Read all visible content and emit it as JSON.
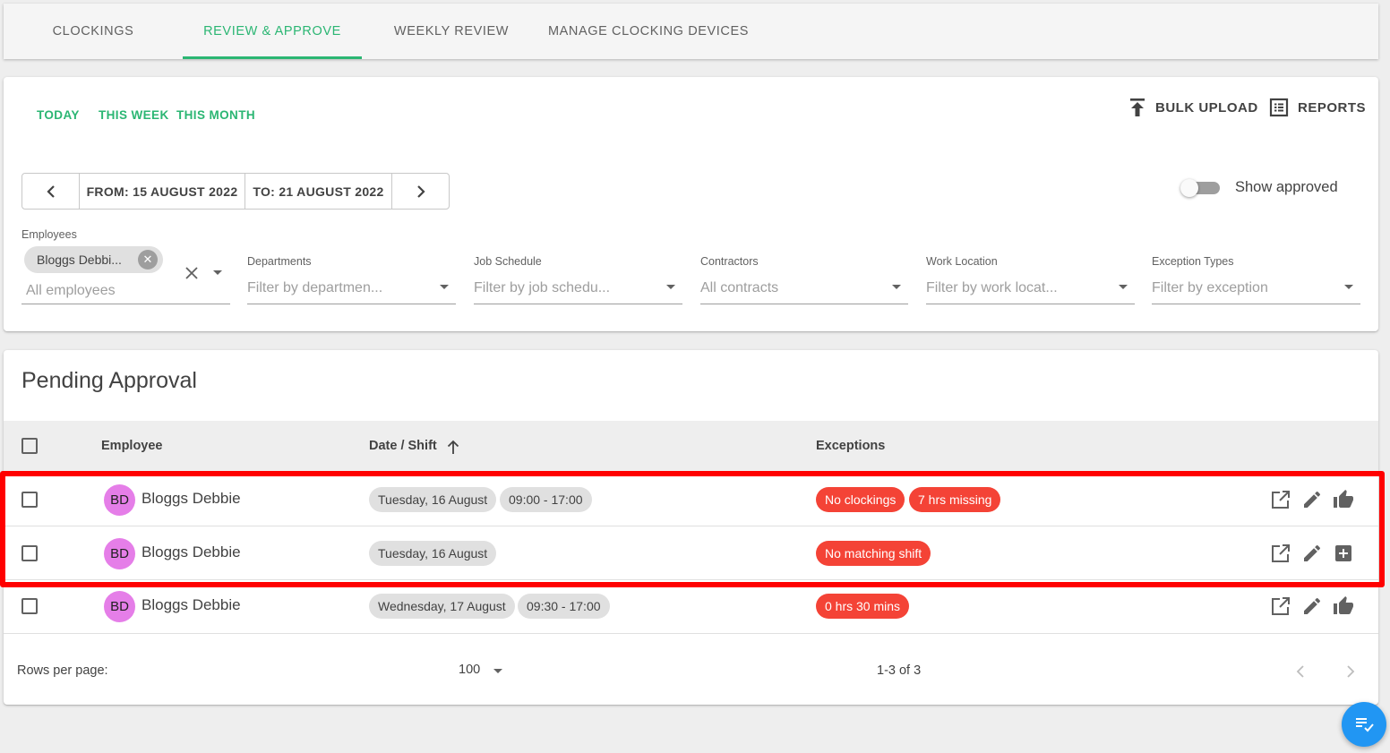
{
  "tabs": [
    "CLOCKINGS",
    "REVIEW & APPROVE",
    "WEEKLY REVIEW",
    "MANAGE CLOCKING DEVICES"
  ],
  "active_tab": "REVIEW & APPROVE",
  "quick_ranges": [
    "TODAY",
    "THIS WEEK",
    "THIS MONTH"
  ],
  "actions": {
    "bulk_upload": "BULK UPLOAD",
    "reports": "REPORTS"
  },
  "date_range": {
    "from": "FROM: 15 AUGUST 2022",
    "to": "TO: 21 AUGUST 2022"
  },
  "show_approved": {
    "label": "Show approved",
    "on": false
  },
  "filters": {
    "employees": {
      "label": "Employees",
      "chip": "Bloggs Debbi...",
      "placeholder": "All employees"
    },
    "departments": {
      "label": "Departments",
      "placeholder": "Filter by departmen..."
    },
    "job_schedule": {
      "label": "Job Schedule",
      "placeholder": "Filter by job schedu..."
    },
    "contractors": {
      "label": "Contractors",
      "placeholder": "All contracts"
    },
    "work_location": {
      "label": "Work Location",
      "placeholder": "Filter by work locat..."
    },
    "exception_types": {
      "label": "Exception Types",
      "placeholder": "Filter by exception"
    }
  },
  "pending": {
    "title": "Pending Approval",
    "columns": {
      "employee": "Employee",
      "date_shift": "Date / Shift",
      "exceptions": "Exceptions"
    },
    "rows": [
      {
        "initials": "BD",
        "name": "Bloggs Debbie",
        "date": "Tuesday, 16 August",
        "shift": "09:00 - 17:00",
        "exceptions": [
          "No clockings",
          "7 hrs missing"
        ],
        "last_action": "thumb-up-icon"
      },
      {
        "initials": "BD",
        "name": "Bloggs Debbie",
        "date": "Tuesday, 16 August",
        "shift": "",
        "exceptions": [
          "No matching shift"
        ],
        "last_action": "add-box-icon"
      },
      {
        "initials": "BD",
        "name": "Bloggs Debbie",
        "date": "Wednesday, 17 August",
        "shift": "09:30 - 17:00",
        "exceptions": [
          "0 hrs 30 mins"
        ],
        "last_action": "thumb-up-icon"
      }
    ],
    "footer": {
      "rows_per_page_label": "Rows per page:",
      "rows_per_page": "100",
      "range": "1-3 of 3"
    }
  },
  "colors": {
    "accent": "#2bb673",
    "exception": "#f44336",
    "avatar": "#e57ee8",
    "highlight": "#ff0000",
    "fab": "#2196f3"
  }
}
